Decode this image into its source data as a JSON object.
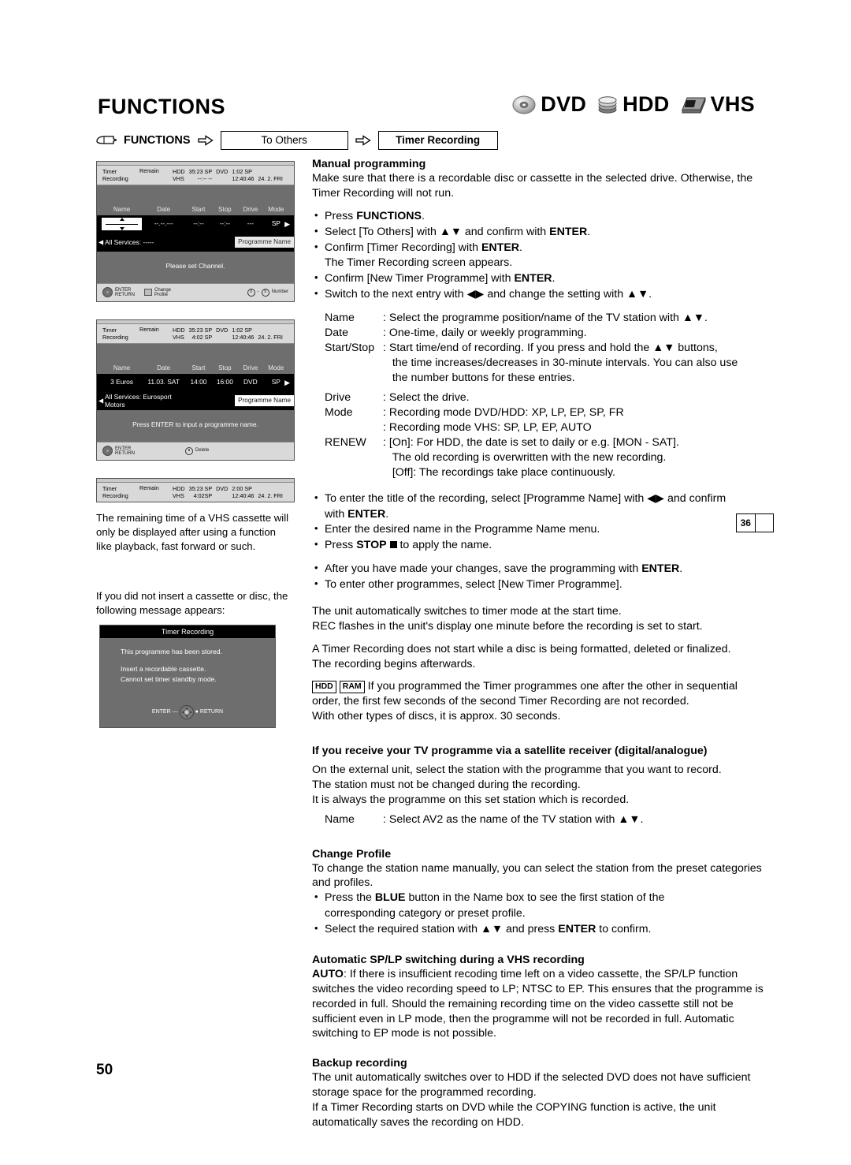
{
  "header": {
    "title": "FUNCTIONS",
    "media_badges": [
      {
        "icon": "dvd-disc-icon",
        "label": "DVD"
      },
      {
        "icon": "hdd-stack-icon",
        "label": "HDD"
      },
      {
        "icon": "vhs-cassette-icon",
        "label": "VHS"
      }
    ]
  },
  "breadcrumb": {
    "hand_icon": "pointing-hand-icon",
    "start": "FUNCTIONS",
    "step1": "To Others",
    "step2": "Timer Recording"
  },
  "screens": [
    {
      "status": {
        "title_line1": "Timer",
        "title_line2": "Recording",
        "remain_label": "Remain",
        "hdd_label": "HDD",
        "hdd_value": "35:23 SP",
        "vhs_label": "VHS",
        "vhs_value": "--:--  --",
        "dvd_label": "DVD",
        "dvd_value": "1:02 SP",
        "clock": "12:40:46",
        "date": "24. 2. FRI"
      },
      "columns": [
        "Name",
        "Date",
        "Start",
        "Stop",
        "Drive",
        "Mode"
      ],
      "row": {
        "name": "",
        "date": "--.--.---",
        "start": "--:--",
        "stop": "--:--",
        "drive": "---",
        "mode": "SP"
      },
      "service_line1": "All Services: -----",
      "service_line2": "",
      "programme_name_chip": "Programme Name",
      "hint": "Please set Channel.",
      "footer": {
        "enter": "ENTER",
        "return": "RETURN",
        "change_profile_line1": "Change",
        "change_profile_line2": "Profile",
        "number_from": "0",
        "number_to": "9",
        "number_label": "Number"
      }
    },
    {
      "status": {
        "title_line1": "Timer",
        "title_line2": "Recording",
        "remain_label": "Remain",
        "hdd_label": "HDD",
        "hdd_value": "35:23 SP",
        "vhs_label": "VHS",
        "vhs_value": "4:02 SP",
        "dvd_label": "DVD",
        "dvd_value": "1:02 SP",
        "clock": "12:40:46",
        "date": "24. 2. FRI"
      },
      "columns": [
        "Name",
        "Date",
        "Start",
        "Stop",
        "Drive",
        "Mode"
      ],
      "row": {
        "name": "3 Euros",
        "date": "11.03. SAT",
        "start": "14:00",
        "stop": "16:00",
        "drive": "DVD",
        "mode": "SP"
      },
      "service_line1": "All Services: Eurosport",
      "service_line2": "Motors",
      "programme_name_chip": "Programme Name",
      "hint": "Press ENTER to input a programme name.",
      "footer": {
        "enter": "ENTER",
        "return": "RETURN",
        "delete_label": "Delete"
      }
    }
  ],
  "screen3": {
    "status": {
      "title_line1": "Timer",
      "title_line2": "Recording",
      "remain_label": "Remain",
      "hdd_label": "HDD",
      "hdd_value": "35:23 SP",
      "vhs_label": "VHS",
      "vhs_value": "4:02SP",
      "dvd_label": "DVD",
      "dvd_value": "2:00 SP",
      "clock": "12:40:46",
      "date": "24. 2. FRI"
    }
  },
  "left_notes": {
    "note1": "The remaining time of a VHS cassette will only be displayed after using a function like playback, fast forward or such.",
    "note2": "If you did not insert a cassette or disc, the following message appears:"
  },
  "dialog": {
    "title": "Timer Recording",
    "line1": "This programme has been stored.",
    "line2": "Insert a recordable cassette.",
    "line3": "Cannot set timer standby mode.",
    "enter": "ENTER",
    "return": "RETURN"
  },
  "main": {
    "manual": {
      "heading": "Manual programming",
      "intro": "Make sure that there is a recordable disc or cassette in the selected drive. Otherwise, the Timer Recording will not run.",
      "bullets": [
        {
          "html": "Press <span class=\"b\">FUNCTIONS</span>."
        },
        {
          "html": "Select [To Others] with ▲▼ and confirm with <span class=\"b\">ENTER</span>."
        },
        {
          "html": "Confirm [Timer Recording] with <span class=\"b\">ENTER</span>."
        },
        {
          "html": "The Timer Recording screen appears.",
          "nobul": true
        },
        {
          "html": "Confirm [New Timer Programme] with <span class=\"b\">ENTER</span>."
        },
        {
          "html": "Switch to the next entry with ◀▶ and change the setting with ▲▼."
        }
      ]
    },
    "definitions": [
      {
        "key": "Name",
        "value": "Select the programme position/name of the TV station with ▲▼.",
        "colon": true
      },
      {
        "key": "Date",
        "value": "One-time, daily or weekly programming.",
        "colon": true
      },
      {
        "key": "Start/Stop",
        "value": "Start time/end of recording. If you press and hold the ▲▼ buttons,",
        "colon": true
      },
      {
        "key": "",
        "value": "the time increases/decreases in 30-minute intervals. You can also use",
        "colon": false
      },
      {
        "key": "",
        "value": "the number buttons for these entries.",
        "colon": false
      },
      {
        "key": "Drive",
        "value": "Select the drive.",
        "colon": true,
        "spacer_before": true
      },
      {
        "key": "Mode",
        "value": "Recording mode DVD/HDD: XP, LP, EP, SP, FR",
        "colon": true
      },
      {
        "key": "",
        "value": "Recording mode VHS: SP, LP, EP, AUTO",
        "colon": true
      },
      {
        "key": "RENEW",
        "value": "[On]: For HDD, the date is set to daily or e.g. [MON - SAT].",
        "colon": true
      },
      {
        "key": "",
        "value": "The old recording is overwritten with the new recording.",
        "colon": false
      },
      {
        "key": "",
        "value": "[Off]: The recordings take place continuously.",
        "colon": false
      }
    ],
    "bullets2": [
      {
        "html": "To enter the title of the recording, select [Programme Name] with ◀▶ and confirm"
      },
      {
        "html": "with <span class=\"b\">ENTER</span>.",
        "nobul": true
      },
      {
        "html": "Enter the desired name in the Programme Name menu."
      },
      {
        "html": "Press <span class=\"b\">STOP</span> <span class=\"stopsq\"></span> to apply the name."
      }
    ],
    "page_ref": "36",
    "bullets3": [
      {
        "html": "After you have made your changes, save the programming with <span class=\"b\">ENTER</span>."
      },
      {
        "html": "To enter other programmes, select [New Timer Programme]."
      }
    ],
    "para1_line1": "The unit automatically switches to timer mode at the start time.",
    "para1_line2": "REC flashes in the unit's display one minute before the recording is set to start.",
    "para2_line1": "A Timer Recording does not start while a disc is being formatted, deleted or finalized.",
    "para2_line2": "The recording begins afterwards.",
    "tags": [
      "HDD",
      "RAM"
    ],
    "para3_line1": "If you programmed the Timer programmes one after the other in sequential",
    "para3_line2": "order, the first few seconds of the second Timer Recording are not recorded.",
    "para3_line3": "With other types of discs, it is approx. 30 seconds.",
    "satellite": {
      "heading": "If you receive your TV programme via a satellite receiver (digital/analogue)",
      "line1": "On the external unit, select the station with the programme that you want to record.",
      "line2": "The station must not be changed during the recording.",
      "line3": "It is always the programme on this set station which is recorded.",
      "def_key": "Name",
      "def_value": "Select AV2 as the name of the TV station with ▲▼."
    },
    "change_profile": {
      "heading": "Change Profile",
      "intro": "To change the station name manually, you can select the station from the preset categories and profiles.",
      "bullets": [
        {
          "html": "Press the <span class=\"b\">BLUE</span> button in the Name box to see the first station of the"
        },
        {
          "html": "corresponding category or preset profile.",
          "nobul": true
        },
        {
          "html": "Select the required station with ▲▼ and press <span class=\"b\">ENTER</span> to confirm."
        }
      ]
    },
    "auto_splp": {
      "heading": "Automatic SP/LP switching during a VHS recording",
      "body_html": "<span class=\"b\">AUTO</span>: If there is insufficient recoding time left on a video cassette, the SP/LP function switches the video recording speed to LP; NTSC to EP. This ensures that the programme is recorded in full. Should the remaining recording time on the video cassette still not be sufficient even in LP mode, then the programme will not be recorded in full. Automatic switching to EP mode is not possible."
    },
    "backup": {
      "heading": "Backup recording",
      "line1": "The unit automatically switches over to HDD if the selected DVD does not have sufficient storage space for the programmed recording.",
      "line2": "If a Timer Recording starts on DVD while the COPYING function is active, the unit automatically saves the recording on HDD."
    }
  },
  "page_number": "50"
}
